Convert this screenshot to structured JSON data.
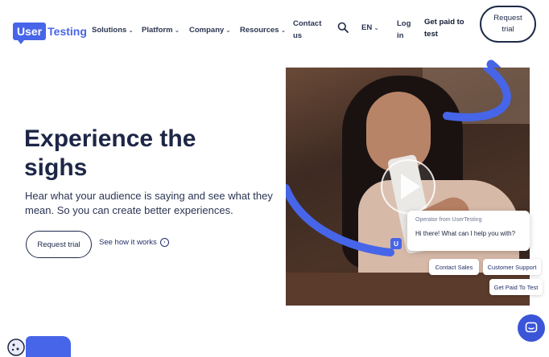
{
  "nav": {
    "logo_box": "User",
    "logo_text": "Testing",
    "items": [
      {
        "label": "Solutions"
      },
      {
        "label": "Platform"
      },
      {
        "label": "Company"
      },
      {
        "label": "Resources"
      }
    ],
    "contact": [
      "Contact",
      "us"
    ],
    "language": "EN",
    "login": [
      "Log",
      "in"
    ],
    "get_paid": [
      "Get paid to",
      "test"
    ],
    "request_trial": "Request trial"
  },
  "hero": {
    "headline": "Experience the sighs",
    "subtext": "Hear what your audience is saying and see what they mean. So you can create better experiences.",
    "cta_trial": "Request trial",
    "cta_how": "See how it works"
  },
  "chat": {
    "from": "Operator from UserTesting",
    "message": "Hi there! What can I help you with?",
    "logo_letter": "U",
    "chips": [
      "Contact Sales",
      "Customer Support",
      "Get Paid To Test"
    ]
  },
  "colors": {
    "brand_blue": "#4765e8",
    "dark_navy": "#1d2646",
    "messenger_blue": "#3b55d9"
  },
  "icons": {
    "search": "search-icon",
    "play": "play-icon",
    "messenger": "chat-bubble-icon",
    "cookie": "cookie-icon"
  }
}
